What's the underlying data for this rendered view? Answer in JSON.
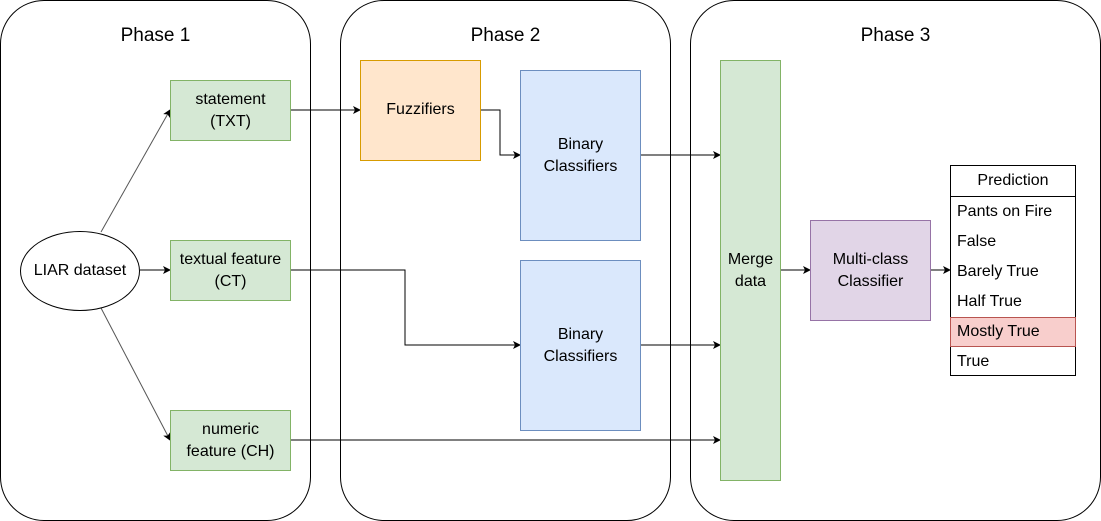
{
  "phases": [
    {
      "title": "Phase 1"
    },
    {
      "title": "Phase 2"
    },
    {
      "title": "Phase 3"
    }
  ],
  "nodes": {
    "dataset": "LIAR dataset",
    "statement": [
      "statement",
      "(TXT)"
    ],
    "textual": [
      "textual feature",
      "(CT)"
    ],
    "numeric": [
      "numeric",
      "feature (CH)"
    ],
    "fuzzifiers": "Fuzzifiers",
    "binary1": [
      "Binary",
      "Classifiers"
    ],
    "binary2": [
      "Binary",
      "Classifiers"
    ],
    "merge": [
      "Merge",
      "data"
    ],
    "multiclass": [
      "Multi-class",
      "Classifier"
    ]
  },
  "prediction": {
    "header": "Prediction",
    "rows": [
      "Pants on Fire",
      "False",
      "Barely True",
      "Half True",
      "Mostly True",
      "True"
    ],
    "highlighted": "Mostly True"
  },
  "colors": {
    "green": "#d5e8d4",
    "orange": "#ffe6cc",
    "blue": "#dae8fc",
    "purple": "#e1d5e7",
    "highlight": "#f8cecc"
  }
}
